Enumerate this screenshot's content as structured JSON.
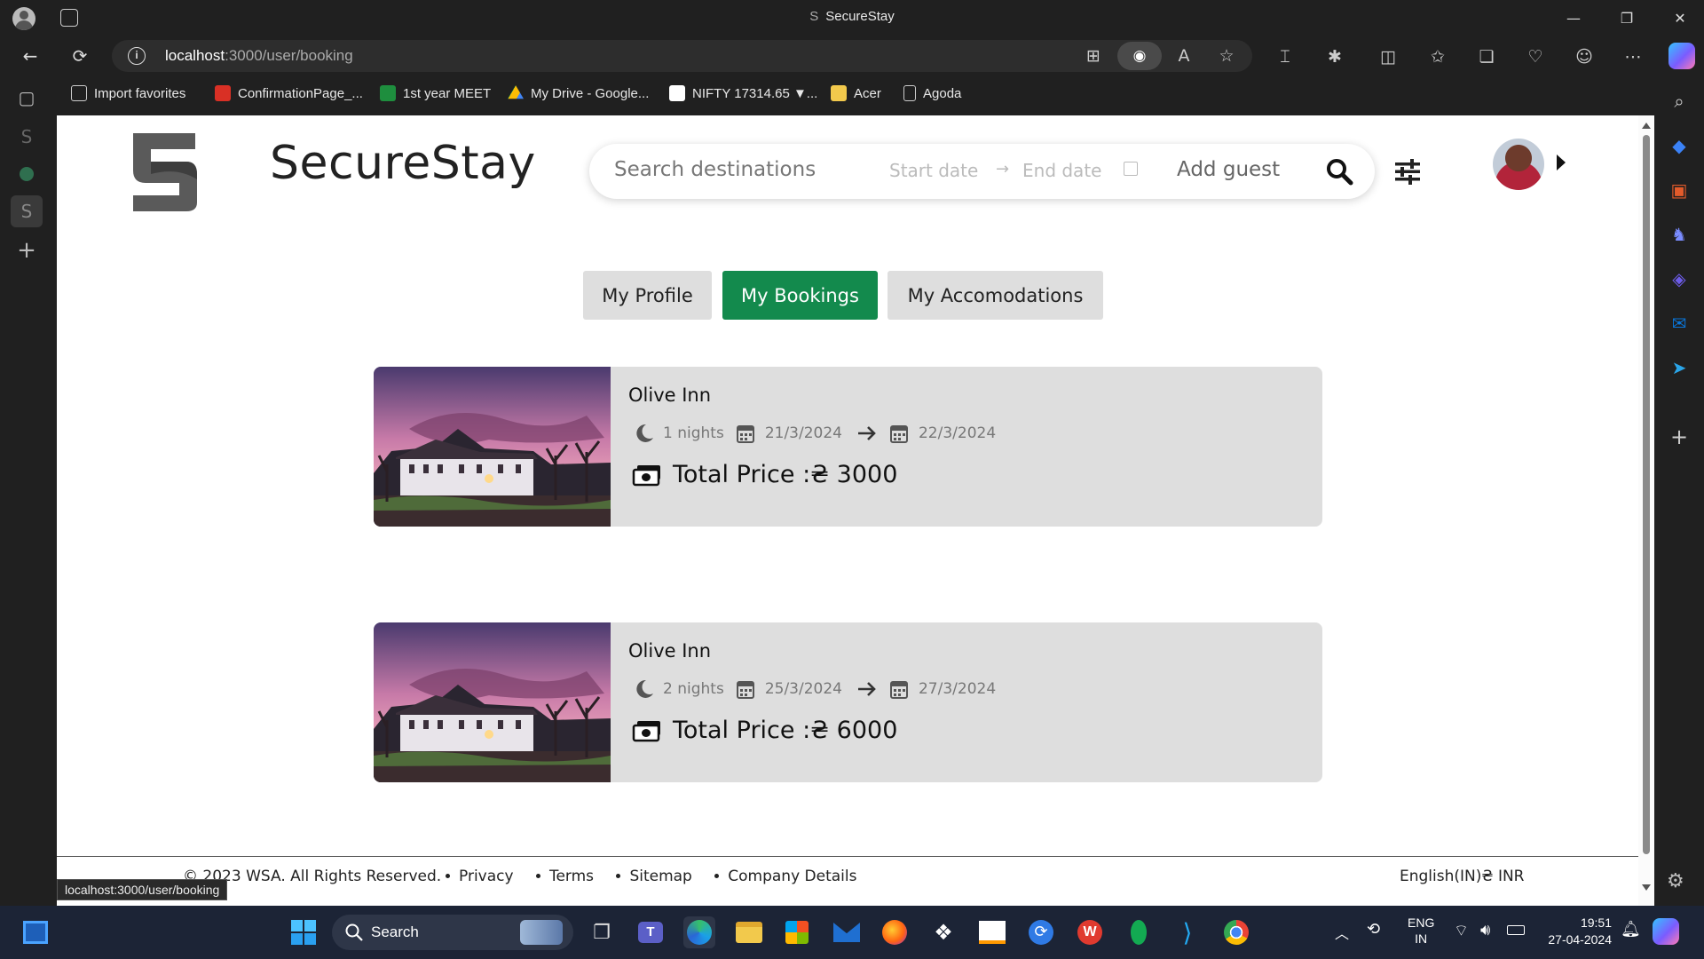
{
  "window": {
    "title": "SecureStay",
    "controls": {
      "minimize": "—",
      "restore": "❐",
      "close": "✕"
    }
  },
  "browser": {
    "url_host": "localhost",
    "url_path": ":3000/user/booking",
    "status_url": "localhost:3000/user/booking",
    "favorites": [
      {
        "label": "Import favorites",
        "color": "#cfcfcf"
      },
      {
        "label": "ConfirmationPage_...",
        "color": "#d93025"
      },
      {
        "label": "1st year MEET",
        "color": "#1e8e3e"
      },
      {
        "label": "My Drive - Google...",
        "color": "#fbbc04"
      },
      {
        "label": "NIFTY 17314.65 ▼...",
        "color": "#ffffff"
      },
      {
        "label": "Acer",
        "color": "#f2c94c"
      },
      {
        "label": "Agoda",
        "color": "#cfcfcf"
      }
    ]
  },
  "site": {
    "brand": "SecureStay",
    "search": {
      "destination_placeholder": "Search destinations",
      "start_placeholder": "Start date",
      "end_placeholder": "End date",
      "guest_placeholder": "Add guest"
    },
    "tabs": [
      {
        "label": "My Profile",
        "active": false
      },
      {
        "label": "My Bookings",
        "active": true
      },
      {
        "label": "My Accomodations",
        "active": false
      }
    ],
    "bookings": [
      {
        "hotel": "Olive Inn",
        "nights": "1 nights",
        "start": "21/3/2024",
        "end": "22/3/2024",
        "price": "Total Price :₴ 3000"
      },
      {
        "hotel": "Olive Inn",
        "nights": "2 nights",
        "start": "25/3/2024",
        "end": "27/3/2024",
        "price": "Total Price :₴ 6000"
      }
    ],
    "footer": {
      "copyright": "© 2023 WSA. All Rights Reserved.",
      "links": [
        "Privacy",
        "Terms",
        "Sitemap",
        "Company Details"
      ],
      "locale": "English(IN)₴ INR"
    },
    "accent": "#138a4d"
  },
  "taskbar": {
    "search_label": "Search",
    "lang": "ENG",
    "region": "IN",
    "time": "19:51",
    "date": "27-04-2024"
  }
}
